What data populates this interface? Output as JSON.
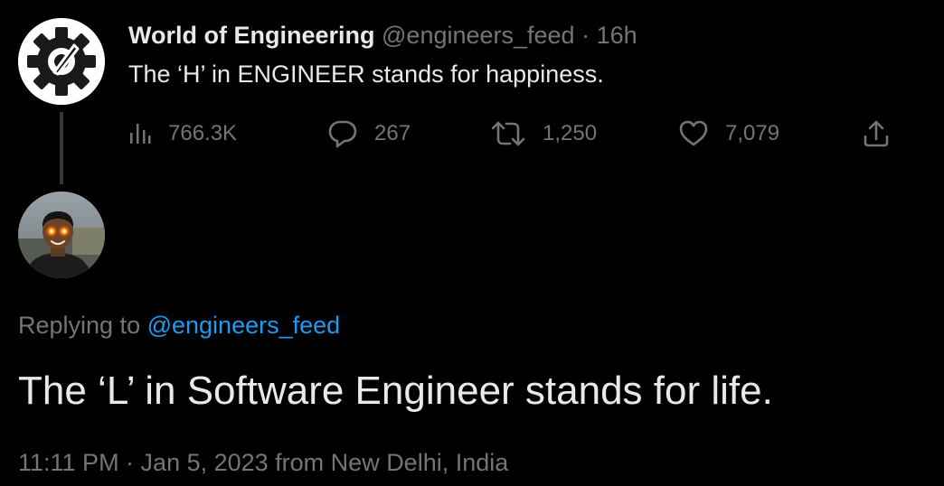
{
  "colors": {
    "background": "#000000",
    "primary_text": "#e7e9ea",
    "secondary_text": "#71767b",
    "accent": "#1d9bf0",
    "thread_line": "#333639"
  },
  "parent_tweet": {
    "avatar_icon": "gear-logo-icon",
    "author_name": "World of Engineering",
    "handle": "@engineers_feed",
    "separator": " · ",
    "time": "16h",
    "text": "The ‘H’ in ENGINEER stands for happiness.",
    "actions": {
      "views": {
        "icon": "bar-chart-icon",
        "count": "766.3K"
      },
      "reply": {
        "icon": "comment-bubble-icon",
        "count": "267"
      },
      "retweet": {
        "icon": "retweet-icon",
        "count": "1,250"
      },
      "like": {
        "icon": "heart-icon",
        "count": "7,079"
      },
      "share": {
        "icon": "share-upload-icon"
      }
    }
  },
  "reply_tweet": {
    "avatar_icon": "user-photo-avatar",
    "replying_to_label": "Replying to ",
    "replying_to_handle": "@engineers_feed",
    "text": "The ‘L’ in Software Engineer stands for life.",
    "timestamp": "11:11 PM · Jan 5, 2023 from New Delhi, India"
  }
}
